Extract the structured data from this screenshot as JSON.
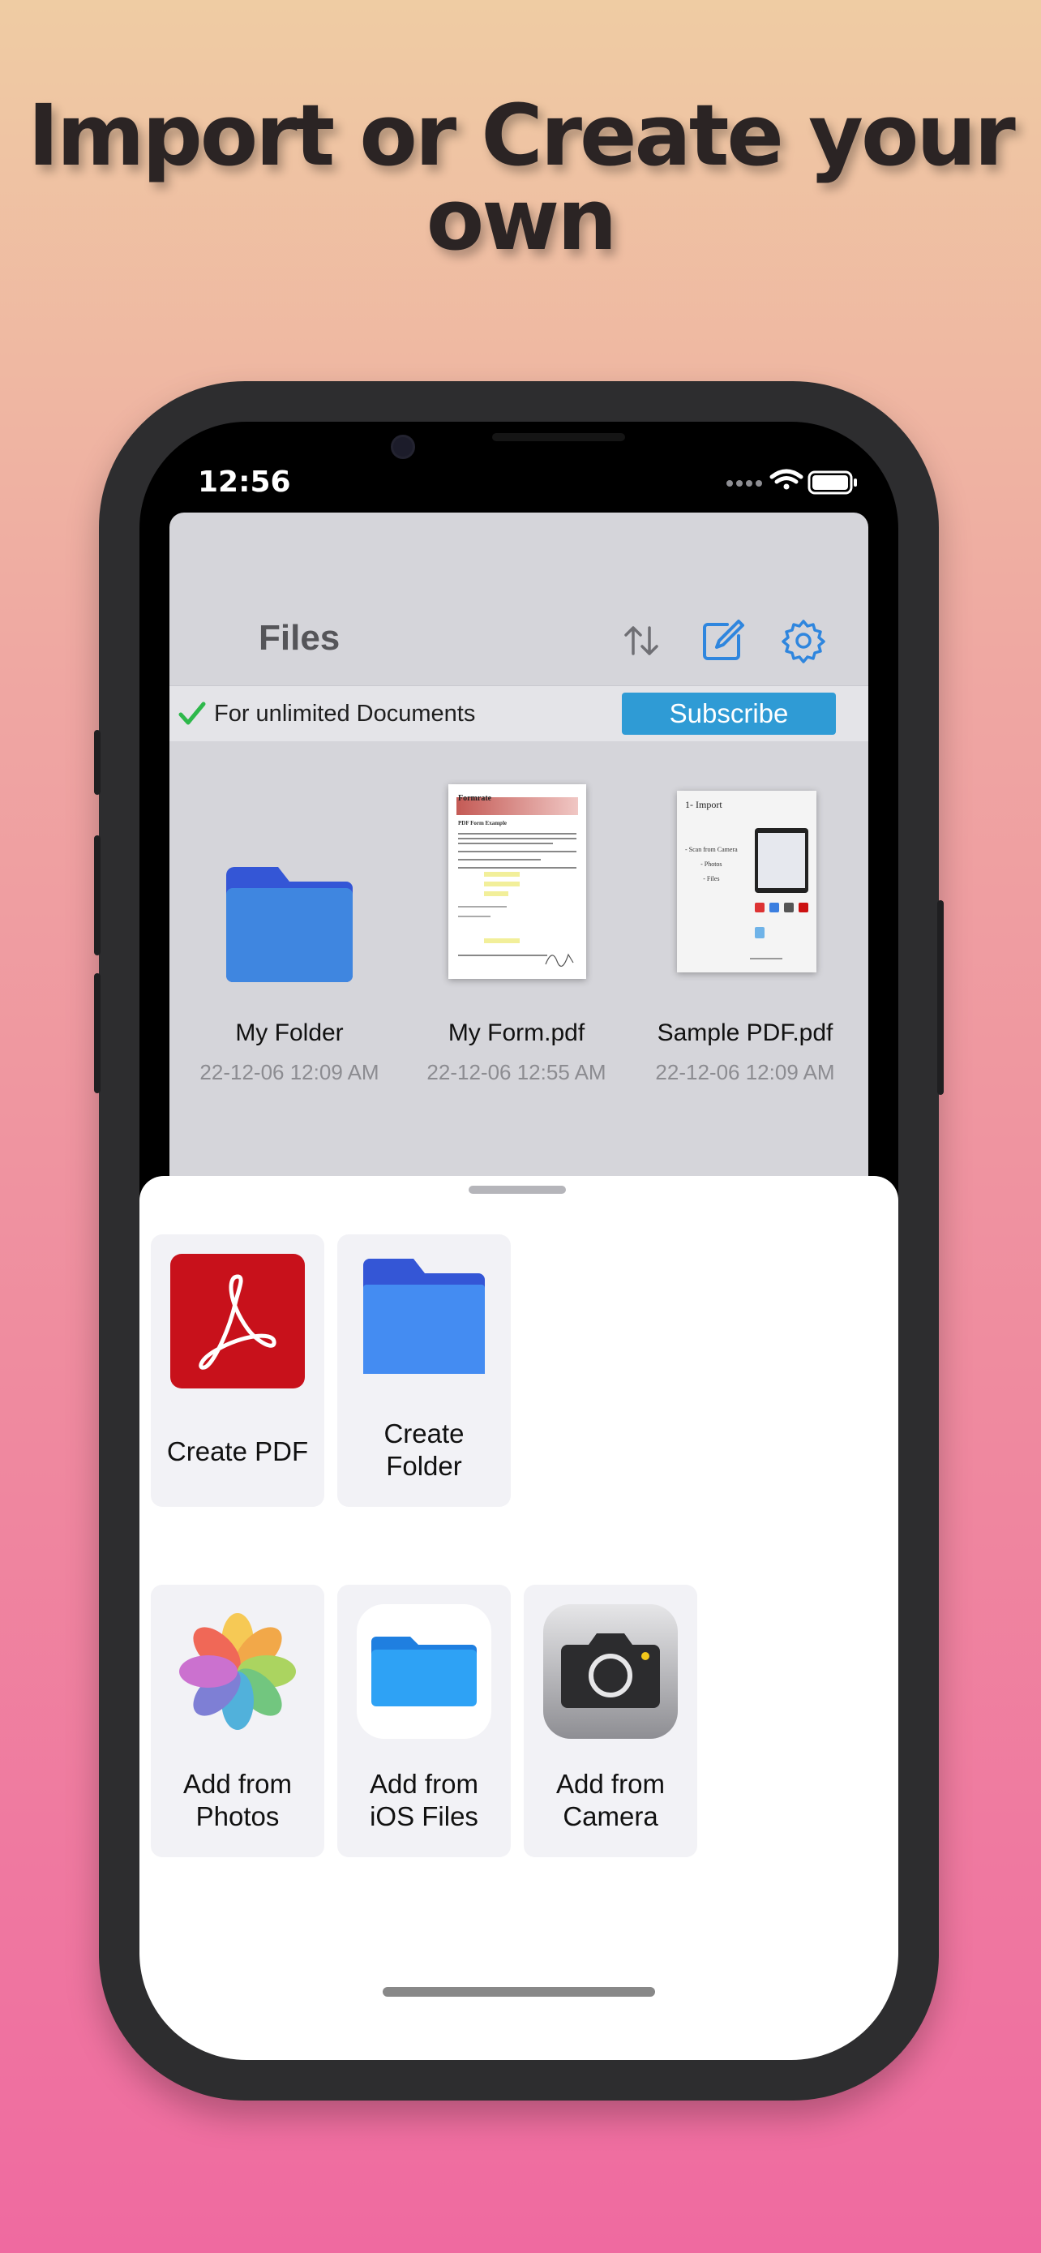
{
  "headline": {
    "line1": "Import or Create your",
    "line2": "own"
  },
  "status_bar": {
    "time": "12:56"
  },
  "app": {
    "title": "Files",
    "toolbar": {
      "sort_icon": "sort-arrows-icon",
      "compose_icon": "compose-icon",
      "settings_icon": "gear-icon"
    },
    "banner": {
      "text": "For unlimited Documents",
      "button": "Subscribe"
    },
    "files": [
      {
        "name": "My Folder",
        "date": "22-12-06 12:09 AM",
        "kind": "folder"
      },
      {
        "name": "My Form.pdf",
        "date": "22-12-06 12:55 AM",
        "kind": "pdf"
      },
      {
        "name": "Sample PDF.pdf",
        "date": "22-12-06 12:09 AM",
        "kind": "pdf"
      }
    ],
    "thumbnails": {
      "form_header": "Formrate",
      "form_heading": "PDF Form Example",
      "sample_title": "1- Import",
      "sample_lines": [
        "- Scan from Camera",
        "- Photos",
        "- Files"
      ]
    }
  },
  "sheet": {
    "create": [
      {
        "label_line1": "Create PDF",
        "label_line2": ""
      },
      {
        "label_line1": "Create",
        "label_line2": "Folder"
      }
    ],
    "add": [
      {
        "label_line1": "Add from",
        "label_line2": "Photos"
      },
      {
        "label_line1": "Add from",
        "label_line2": "iOS Files"
      },
      {
        "label_line1": "Add from",
        "label_line2": "Camera"
      }
    ]
  },
  "colors": {
    "accent": "#2f9bd5",
    "folder_blue": "#3f86e0",
    "pdf_red": "#c8111b",
    "check_green": "#2eb84b"
  }
}
